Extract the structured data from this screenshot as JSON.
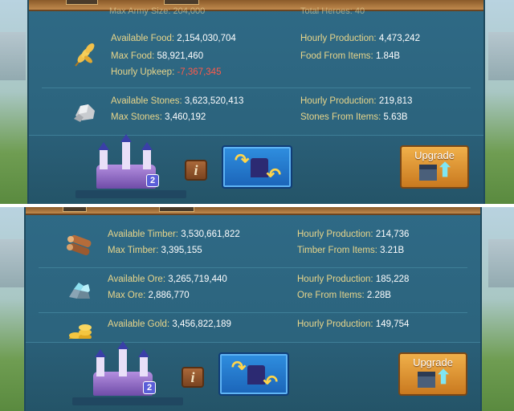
{
  "top_screenshot": {
    "ghost_labels": {
      "max_army": "Max Army Size: 204,000",
      "total_heroes": "Total Heroes: 40"
    },
    "food": {
      "icon": "wheat-icon",
      "available_label": "Available Food:",
      "available_value": "2,154,030,704",
      "max_label": "Max Food:",
      "max_value": "58,921,460",
      "upkeep_label": "Hourly Upkeep:",
      "upkeep_value": "-7,367,345",
      "hourly_label": "Hourly Production:",
      "hourly_value": "4,473,242",
      "items_label": "Food From Items:",
      "items_value": "1.84B"
    },
    "stone": {
      "icon": "stone-icon",
      "available_label": "Available Stones:",
      "available_value": "3,623,520,413",
      "max_label": "Max Stones:",
      "max_value": "3,460,192",
      "hourly_label": "Hourly Production:",
      "hourly_value": "219,813",
      "items_label": "Stones From Items:",
      "items_value": "5.63B"
    },
    "castle_level": "2",
    "info_label": "i",
    "upgrade_label": "Upgrade"
  },
  "bottom_screenshot": {
    "timber": {
      "icon": "timber-icon",
      "available_label": "Available Timber:",
      "available_value": "3,530,661,822",
      "max_label": "Max Timber:",
      "max_value": "3,395,155",
      "hourly_label": "Hourly Production:",
      "hourly_value": "214,736",
      "items_label": "Timber From Items:",
      "items_value": "3.21B"
    },
    "ore": {
      "icon": "ore-icon",
      "available_label": "Available Ore:",
      "available_value": "3,265,719,440",
      "max_label": "Max Ore:",
      "max_value": "2,886,770",
      "hourly_label": "Hourly Production:",
      "hourly_value": "185,228",
      "items_label": "Ore From Items:",
      "items_value": "2.28B"
    },
    "gold": {
      "icon": "gold-icon",
      "available_label": "Available Gold:",
      "available_value": "3,456,822,189",
      "hourly_label": "Hourly Production:",
      "hourly_value": "149,754"
    },
    "castle_level": "2",
    "info_label": "i",
    "upgrade_label": "Upgrade"
  },
  "colors": {
    "label": "#e8d58a",
    "value": "#ffffff",
    "negative": "#ff5a4a",
    "panel": "#2f6a86",
    "upgrade_button": "#e09a38",
    "swap_button": "#2474cc"
  }
}
